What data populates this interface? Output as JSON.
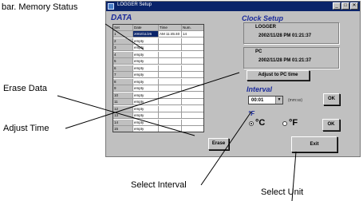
{
  "window": {
    "title": "LOGGER Setup",
    "controls": [
      "_",
      "□",
      "✕"
    ]
  },
  "data_section": {
    "title": "DATA",
    "columns": [
      "Set",
      "Date",
      "Time",
      "Num."
    ],
    "rows": [
      [
        "1",
        "2002/11/26",
        "AM 11:45:40",
        "14"
      ],
      [
        "2",
        "empty",
        "",
        ""
      ],
      [
        "3",
        "empty",
        "",
        ""
      ],
      [
        "4",
        "empty",
        "",
        ""
      ],
      [
        "5",
        "empty",
        "",
        ""
      ],
      [
        "6",
        "empty",
        "",
        ""
      ],
      [
        "7",
        "empty",
        "",
        ""
      ],
      [
        "8",
        "empty",
        "",
        ""
      ],
      [
        "9",
        "empty",
        "",
        ""
      ],
      [
        "10",
        "empty",
        "",
        ""
      ],
      [
        "11",
        "empty",
        "",
        ""
      ],
      [
        "12",
        "empty",
        "",
        ""
      ],
      [
        "13",
        "empty",
        "",
        ""
      ],
      [
        "14",
        "empty",
        "",
        ""
      ],
      [
        "15",
        "empty",
        "",
        ""
      ]
    ],
    "erase_label": "Erase"
  },
  "clock_setup": {
    "title": "Clock Setup",
    "logger_label": "LOGGER",
    "logger_time": "2002/11/28 PM 01:21:37",
    "pc_label": "PC",
    "pc_time": "2002/11/28 PM 01:21:37",
    "adjust_label": "Adjust to PC time"
  },
  "interval": {
    "title": "Interval",
    "value": "00:01",
    "unit_hint": "(mm:ss)",
    "ok_label": "OK"
  },
  "unit": {
    "title": "°F",
    "options": [
      "°C",
      "°F"
    ],
    "selected": "°C",
    "ok_label": "OK"
  },
  "exit_label": "Exit",
  "callouts": {
    "memory_status": "bar. Memory Status",
    "erase_data": "Erase Data",
    "adjust_time": "Adjust Time",
    "select_interval": "Select Interval",
    "select_unit": "Select Unit"
  }
}
